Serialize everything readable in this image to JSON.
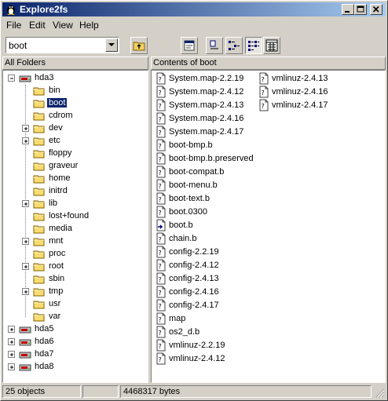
{
  "window": {
    "title": "Explore2fs"
  },
  "menu": [
    "File",
    "Edit",
    "View",
    "Help"
  ],
  "toolbar": {
    "path_value": "boot"
  },
  "left_pane": {
    "header": "All Folders",
    "drive": "hda3",
    "folders": [
      {
        "name": "bin",
        "expandable": false
      },
      {
        "name": "boot",
        "expandable": false,
        "selected": true
      },
      {
        "name": "cdrom",
        "expandable": false
      },
      {
        "name": "dev",
        "expandable": true
      },
      {
        "name": "etc",
        "expandable": true
      },
      {
        "name": "floppy",
        "expandable": false
      },
      {
        "name": "graveur",
        "expandable": false
      },
      {
        "name": "home",
        "expandable": false
      },
      {
        "name": "initrd",
        "expandable": false
      },
      {
        "name": "lib",
        "expandable": true
      },
      {
        "name": "lost+found",
        "expandable": false
      },
      {
        "name": "media",
        "expandable": false
      },
      {
        "name": "mnt",
        "expandable": true
      },
      {
        "name": "proc",
        "expandable": false
      },
      {
        "name": "root",
        "expandable": true
      },
      {
        "name": "sbin",
        "expandable": false
      },
      {
        "name": "tmp",
        "expandable": true
      },
      {
        "name": "usr",
        "expandable": false
      },
      {
        "name": "var",
        "expandable": false
      }
    ],
    "other_drives": [
      "hda5",
      "hda6",
      "hda7",
      "hda8"
    ]
  },
  "right_pane": {
    "header": "Contents of boot",
    "columns": [
      [
        {
          "name": "System.map-2.2.19",
          "icon": "doc-icon"
        },
        {
          "name": "System.map-2.4.12",
          "icon": "doc-icon"
        },
        {
          "name": "System.map-2.4.13",
          "icon": "doc-icon"
        },
        {
          "name": "System.map-2.4.16",
          "icon": "doc-icon"
        },
        {
          "name": "System.map-2.4.17",
          "icon": "doc-icon"
        },
        {
          "name": "boot-bmp.b",
          "icon": "doc-icon"
        },
        {
          "name": "boot-bmp.b.preserved",
          "icon": "doc-icon"
        },
        {
          "name": "boot-compat.b",
          "icon": "doc-icon"
        },
        {
          "name": "boot-menu.b",
          "icon": "doc-icon"
        },
        {
          "name": "boot-text.b",
          "icon": "doc-icon"
        },
        {
          "name": "boot.0300",
          "icon": "doc-icon"
        },
        {
          "name": "boot.b",
          "icon": "shortcut-icon"
        },
        {
          "name": "chain.b",
          "icon": "doc-icon"
        },
        {
          "name": "config-2.2.19",
          "icon": "doc-icon"
        },
        {
          "name": "config-2.4.12",
          "icon": "doc-icon"
        },
        {
          "name": "config-2.4.13",
          "icon": "doc-icon"
        },
        {
          "name": "config-2.4.16",
          "icon": "doc-icon"
        },
        {
          "name": "config-2.4.17",
          "icon": "doc-icon"
        },
        {
          "name": "map",
          "icon": "doc-icon"
        },
        {
          "name": "os2_d.b",
          "icon": "doc-icon"
        },
        {
          "name": "vmlinuz-2.2.19",
          "icon": "doc-icon"
        },
        {
          "name": "vmlinuz-2.4.12",
          "icon": "doc-icon"
        }
      ],
      [
        {
          "name": "vmlinuz-2.4.13",
          "icon": "doc-icon"
        },
        {
          "name": "vmlinuz-2.4.16",
          "icon": "doc-icon"
        },
        {
          "name": "vmlinuz-2.4.17",
          "icon": "doc-icon"
        }
      ]
    ]
  },
  "status": {
    "objects": "25 objects",
    "bytes": "4468317 bytes"
  }
}
